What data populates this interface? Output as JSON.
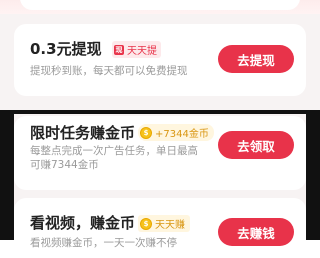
{
  "withdraw": {
    "title": "0.3元提现",
    "tag": "天天提",
    "tag_glyph": "现",
    "subtitle": "提现秒到账，每天都可以免费提现",
    "button": "去提现"
  },
  "task": {
    "title": "限时任务赚金币",
    "reward": "+7344金币",
    "subtitle_line1": "每整点完成一次广告任务，单日最高",
    "subtitle_line2": "可赚7344金币",
    "button": "去领取"
  },
  "video": {
    "title": "看视频，赚金币",
    "tag": "天天赚",
    "subtitle": "看视频赚金币，一天一次赚不停",
    "button": "去赚钱"
  },
  "colors": {
    "accent": "#e8334a",
    "gold": "#d99612"
  },
  "icons": {
    "withdraw_tag": "red-packet-icon",
    "coin": "gold-coin-icon"
  }
}
